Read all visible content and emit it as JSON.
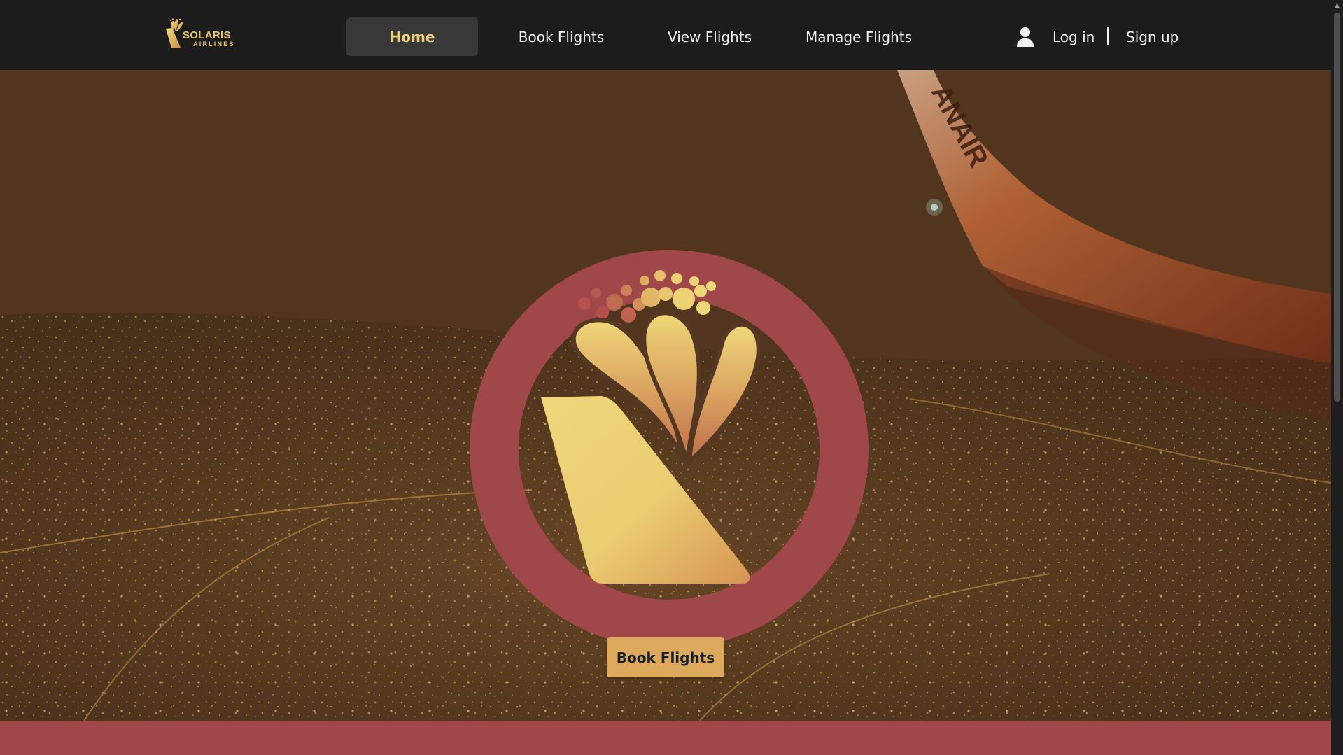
{
  "brand": {
    "name": "SOLARIS",
    "subtitle": "AIRLINES",
    "logo_icon": "solaris-tail-logo-icon"
  },
  "nav": {
    "items": [
      {
        "label": "Home",
        "active": true
      },
      {
        "label": "Book Flights",
        "active": false
      },
      {
        "label": "View Flights",
        "active": false
      },
      {
        "label": "Manage Flights",
        "active": false
      }
    ]
  },
  "auth": {
    "user_icon": "user-icon",
    "login_label": "Log in",
    "signup_label": "Sign up"
  },
  "hero": {
    "background": "night-city-aerial-with-plane-wing",
    "wing_text": "ANAIR",
    "cta_label": "Book Flights"
  },
  "colors": {
    "navbar": "#1c1c1c",
    "nav_active_bg": "#383838",
    "nav_active_text": "#ecd07a",
    "brand_gold": "#e8c665",
    "hero_overlay": "#573a23",
    "logo_ring": "#a0474a",
    "cta_bg": "#dda95c",
    "cta_text": "#17202a",
    "footer_band": "#a0474a"
  }
}
